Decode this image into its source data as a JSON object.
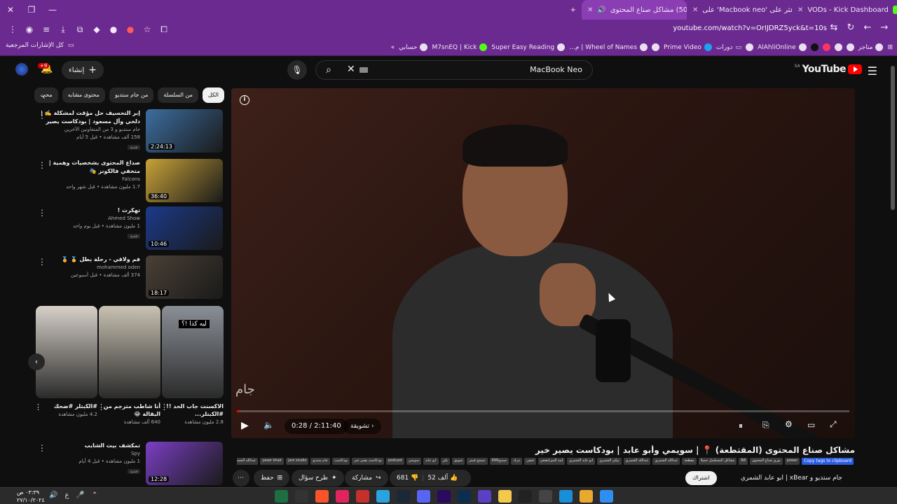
{
  "browser": {
    "tabs": [
      {
        "title": "VODs - Kick Dashboard",
        "color": "#53fc18"
      },
      {
        "title": "اعثر على 'Macbook neo' على",
        "color": "#ffffff"
      },
      {
        "title": "(5086) مشاكل صناع المحتوى",
        "color": "#ff0000",
        "active": true
      }
    ],
    "new_tab": "+",
    "url": "youtube.com/watch?v=OrIJDRZ5yck&t=10s",
    "bookmarks": [
      "متاجر",
      "AlAhliOnline",
      "دورات",
      "Prime Video",
      "Wheel of Names | م...",
      "Super Easy Reading",
      "M7snEQ | Kick",
      "حسابي"
    ],
    "all_bookmarks": "كل الإشارات المرجعية"
  },
  "header": {
    "logo_text": "YouTube",
    "logo_region": "SA",
    "search_query": "MacBook Neo",
    "create_label": "إنشاء",
    "notifications": "+9"
  },
  "player": {
    "time": "0:28 / 2:11:40",
    "chapter": "تشويقة",
    "progress": 0.004,
    "watermark": "جام"
  },
  "video": {
    "title": "مشاكل صناع المحتوى (المقتطعة) 📍 | سويمي وأبو عابد | بودكاست يصير خير",
    "tags_button": "Copy tags to clipboard",
    "tags": [
      "power",
      "نوري صناع المحتوى",
      "R8",
      "مشاكل المسلسل جميلا",
      "مقطعة",
      "عبدالله الشمري",
      "عبدالله الشمري",
      "بيكي الشمري",
      "ابو عابد الشمري",
      "لمة الميرانصعي",
      "فيفي",
      "بترك",
      "جيمنج999",
      "جيمنج فيمز",
      "شوبق",
      "بليز",
      "ابو عابد",
      "سويمي",
      "podcast",
      "بودكاست يصير خير",
      "بودكاست",
      "جام ستديو",
      "jam studio",
      "yaser khair",
      "عبدالله الحسن",
      "يصير خير"
    ],
    "likes": "52 ألف",
    "dislikes": "681",
    "share": "مشاركة",
    "ask": "طرح سؤال",
    "save": "حفظ",
    "subscribe": "اشتراك",
    "channel": "جام ستديو و xBear | ابو عابد الشمري"
  },
  "sidebar": {
    "chips": [
      "الكل",
      "من السلسلة",
      "من جام ستديو",
      "محتوى مشابه",
      "محت"
    ],
    "recommended": [
      {
        "title": "إبر التحسيف حل مؤقت لمشكلة ✍️ | دلخي وآل مسعود | بودكاست يصير خير",
        "channel": "جام ستديو و 3 من المتعاونين الآخرين",
        "views": "158 ألف مشاهدة • قبل 5 أيام",
        "badge": "جديد",
        "duration": "2:24:13",
        "color": "#3c6ea0"
      },
      {
        "title": "صداع المحتوى بشخصيات وهمية | متخفي فالكونز 🎭",
        "channel": "Falcons",
        "views": "1.7 مليون مشاهدة • قبل شهر واحد",
        "badge": "",
        "duration": "36:40",
        "color": "#c8a238"
      },
      {
        "title": "تهكرت !",
        "channel": "Ahmed Show",
        "views": "1 مليون مشاهدة • قبل يوم واحد",
        "badge": "جديد",
        "duration": "10:46",
        "color": "#1b3a8a"
      },
      {
        "title": "فم ولاقي - رحلة بطل 🥇 🏅",
        "channel": "mohammed oden",
        "views": "374 ألف مشاهدة • قبل أسبوعين",
        "badge": "",
        "duration": "18:17",
        "color": "#4a4036"
      },
      {
        "title": "تمكشف بيت الشايب",
        "channel": "Spy",
        "views": "1 مليون مشاهدة • قبل 4 أيام",
        "badge": "جديد",
        "duration": "12:28",
        "color": "#7a3fc4"
      }
    ],
    "shorts": [
      {
        "title": "الاكسنت جاب الحد !! #الكبتلر...",
        "views": "2.8 مليون مشاهدة",
        "color": "#8a8f96"
      },
      {
        "title": "أنا شاطب مترجم من البقالة 😂",
        "views": "640 ألف مشاهدة",
        "color": "#c9c2b3"
      },
      {
        "title": "#الكبتلر #ضحك",
        "views": "4.2 مليون مشاهدة",
        "color": "#d6d0c8"
      }
    ],
    "short_overlay": "ليه كذا !؟"
  },
  "taskbar": {
    "time": "٠٣:٣٩ ص",
    "date": "٢٧/١٠/٢٠٢٤"
  }
}
